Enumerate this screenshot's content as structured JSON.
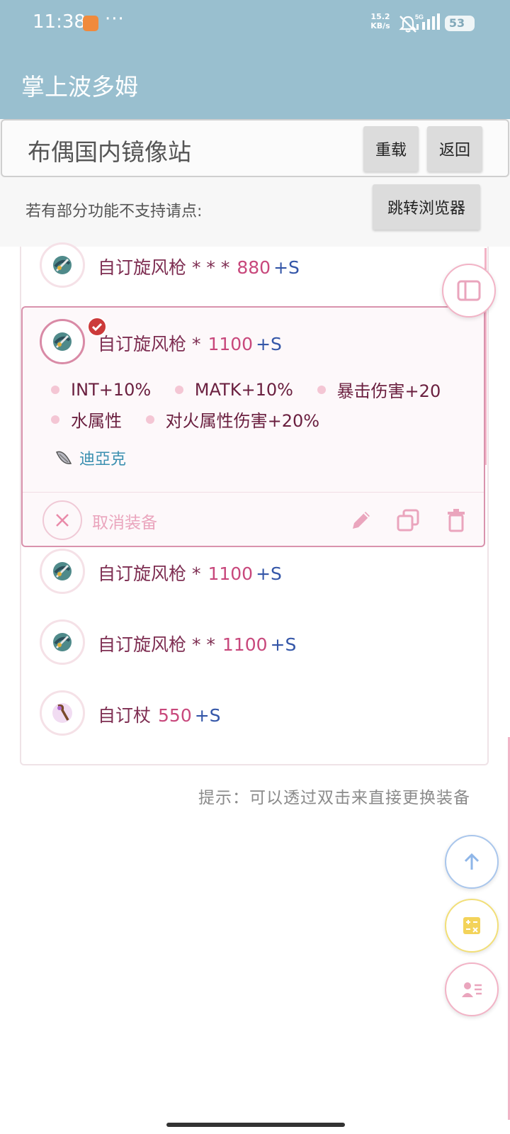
{
  "status_bar": {
    "time": "11:38",
    "more": "···",
    "net_speed_value": "15.2",
    "net_speed_unit": "KB/s",
    "network": "5G",
    "battery": "53"
  },
  "app_title": "掌上波多姆",
  "mirror": {
    "title": "布偶国内镜像站",
    "reload_label": "重载",
    "back_label": "返回",
    "hint": "若有部分功能不支持请点:",
    "browser_label": "跳转浏览器"
  },
  "equipment": {
    "item0": {
      "name": "自订旋风枪 * * *",
      "price": "880",
      "slot": "+S"
    },
    "selected": {
      "name": "自订旋风枪 *",
      "price": "1100",
      "slot": "+S",
      "attr_line1": [
        "INT+10%",
        "MATK+10%",
        "暴击伤害+20"
      ],
      "attr_line2": [
        "水属性",
        "对火属性伤害+20%"
      ],
      "card": "迪亞克",
      "unequip_label": "取消装备"
    },
    "item2": {
      "name": "自订旋风枪 *",
      "price": "1100",
      "slot": "+S"
    },
    "item3": {
      "name": "自订旋风枪 * *",
      "price": "1100",
      "slot": "+S"
    },
    "item4": {
      "name": "自订杖",
      "price": "550",
      "slot": "+S"
    }
  },
  "tip": "提示：可以透过双击来直接更换装备",
  "icons": {
    "app_notification": "shopping-bag-icon",
    "notifications": "bell-off-icon",
    "signal": "signal-icon",
    "panel": "sidebar-toggle-icon",
    "spear": "spear-icon",
    "staff": "staff-icon",
    "card": "card-icon",
    "check": "check-icon",
    "close": "close-icon",
    "edit": "pencil-icon",
    "copy": "copy-icon",
    "delete": "trash-icon",
    "up": "arrow-up-icon",
    "calculator": "calculator-icon",
    "profile": "profile-list-icon"
  },
  "colors": {
    "app_bar": "#99bfcf",
    "item_name": "#7e2e52",
    "price": "#c8487c",
    "slot": "#3456a8",
    "accent_pink": "#d993ad",
    "card_link": "#3a8fb0"
  }
}
